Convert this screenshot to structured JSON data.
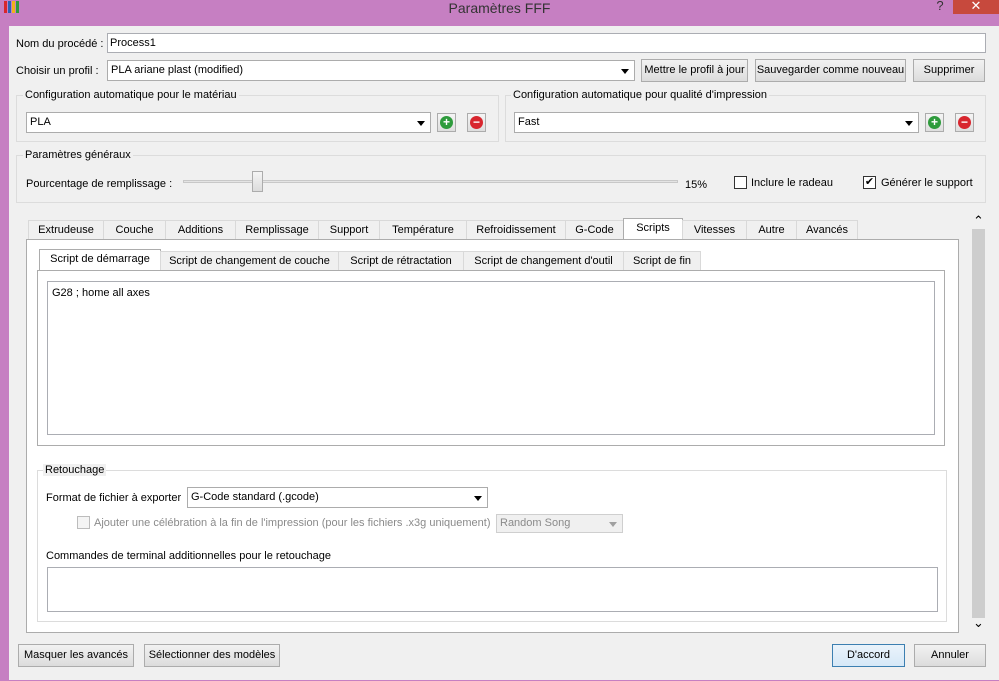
{
  "window": {
    "title": "Paramètres FFF",
    "help": "?",
    "close": "✕"
  },
  "header": {
    "process_name_label": "Nom du procédé :",
    "process_name_value": "Process1",
    "profile_label": "Choisir un profil :",
    "profile_value": "PLA ariane plast (modified)",
    "update_profile": "Mettre le profil à jour",
    "save_new": "Sauvegarder comme nouveau",
    "delete": "Supprimer"
  },
  "material_config": {
    "title": "Configuration automatique pour le matériau",
    "value": "PLA"
  },
  "quality_config": {
    "title": "Configuration automatique pour qualité d'impression",
    "value": "Fast"
  },
  "general": {
    "title": "Paramètres généraux",
    "infill_label": "Pourcentage de remplissage :",
    "infill_value": "15%",
    "infill_percent": 15,
    "raft_label": "Inclure le radeau",
    "raft_checked": false,
    "support_label": "Générer le support",
    "support_checked": true,
    "check_mark": "✔"
  },
  "tabs": [
    "Extrudeuse",
    "Couche",
    "Additions",
    "Remplissage",
    "Support",
    "Température",
    "Refroidissement",
    "G-Code",
    "Scripts",
    "Vitesses",
    "Autre",
    "Avancés"
  ],
  "active_tab": "Scripts",
  "script_tabs": [
    "Script de démarrage",
    "Script de changement de couche",
    "Script de rétractation",
    "Script de changement d'outil",
    "Script de fin"
  ],
  "active_script_tab": "Script de démarrage",
  "script_content": "G28 ; home all axes",
  "retouch": {
    "title": "Retouchage",
    "format_label": "Format de fichier à exporter",
    "format_value": "G-Code standard (.gcode)",
    "celebration_label": "Ajouter une célébration à la fin de l'impression (pour les fichiers .x3g uniquement)",
    "celebration_value": "Random Song",
    "terminal_label": "Commandes de terminal additionnelles pour le retouchage"
  },
  "footer": {
    "hide_advanced": "Masquer les avancés",
    "select_models": "Sélectionner des modèles",
    "ok": "D'accord",
    "cancel": "Annuler"
  },
  "icons": {
    "plus": "+",
    "minus": "−",
    "scroll_up": "⌃",
    "scroll_down": "⌄"
  },
  "colors": {
    "accent": "#3c7fb1",
    "add": "#2e9b3c",
    "remove": "#d8262e",
    "titlebar": "#c67fc2"
  }
}
